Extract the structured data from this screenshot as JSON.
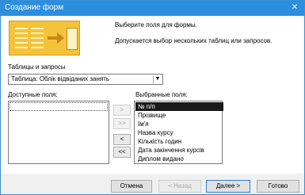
{
  "window": {
    "title": "Создание форм",
    "close_label": "✕"
  },
  "intro": {
    "line1": "Выберите поля для формы.",
    "line2": "Допускается выбор нескольких таблиц или запросов."
  },
  "tables": {
    "label": "Таблицы и запросы",
    "selected": "Таблица: Облік відвіданих занять",
    "arrow": "▼"
  },
  "available": {
    "label": "Доступные поля:",
    "items": [
      ""
    ]
  },
  "selected_fields": {
    "label": "Выбранные поля:",
    "items": [
      "№ п/п",
      "Прізвище",
      "Ім'я",
      "Назва курсу",
      "Кількість годин",
      "Дата закінчення курсів",
      "Диплом видано"
    ]
  },
  "move_buttons": {
    "add": ">",
    "add_all": ">>",
    "remove": "<",
    "remove_all": "<<"
  },
  "footer": {
    "cancel": "Отмена",
    "back": "< Назад",
    "next": "Далее >",
    "finish": "Готово"
  }
}
